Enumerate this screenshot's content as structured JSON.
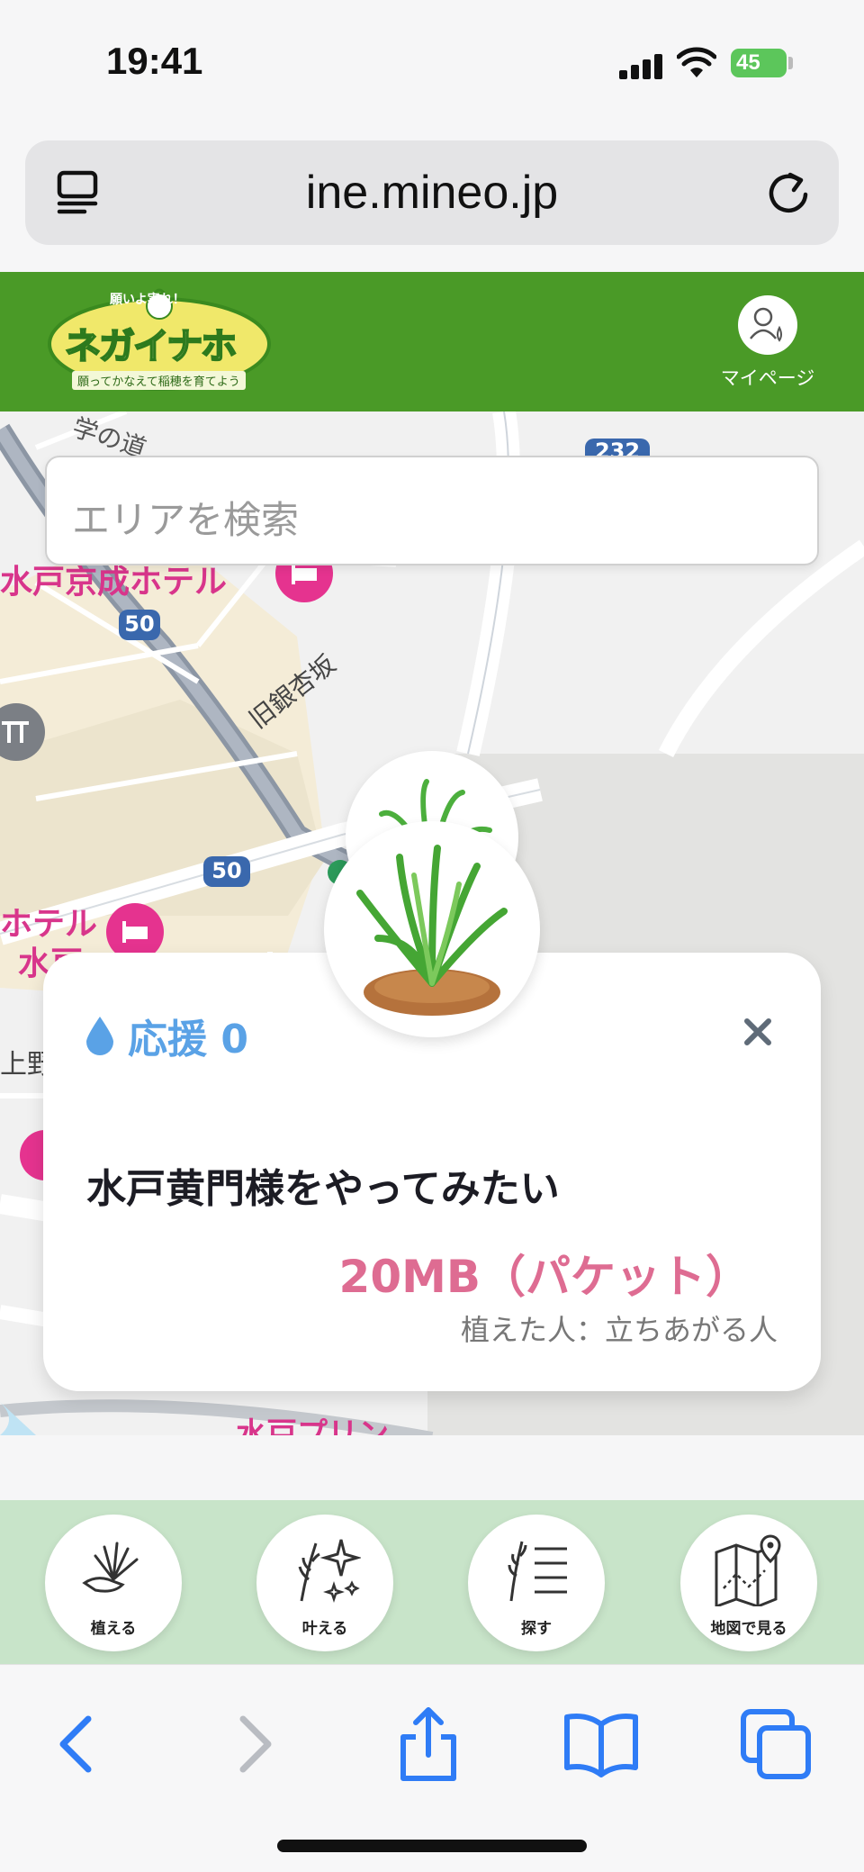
{
  "status_bar": {
    "time": "19:41",
    "battery": "45"
  },
  "browser": {
    "url": "ine.mineo.jp"
  },
  "header": {
    "logo": {
      "main": "ネガイナホ",
      "top": "願いよ実れ！",
      "sub": "願ってかなえて稲穂を育てよう"
    },
    "mypage_label": "マイページ"
  },
  "map": {
    "labels": [
      {
        "text": "学の道"
      },
      {
        "text": "232"
      },
      {
        "text": "水戸京成ホテル"
      },
      {
        "text": "50"
      },
      {
        "text": "旧銀杏坂"
      },
      {
        "text": "50"
      },
      {
        "text": "ホテル"
      },
      {
        "text": "水戸"
      },
      {
        "text": "上野"
      },
      {
        "text": "水戸プリン"
      }
    ]
  },
  "search": {
    "placeholder": "エリアを検索"
  },
  "card": {
    "support_label": "応援 0",
    "wish": "水戸黄門様をやってみたい",
    "reward": "20MB（パケット）",
    "planter": "植えた人：立ちあがる人"
  },
  "bottom_nav": [
    {
      "label": "植える",
      "icon": "plant-hand-icon"
    },
    {
      "label": "叶える",
      "icon": "rice-sparkle-icon"
    },
    {
      "label": "探す",
      "icon": "rice-list-icon"
    },
    {
      "label": "地図で見る",
      "icon": "map-pin-icon"
    }
  ],
  "colors": {
    "header_green": "#4a9a27",
    "nav_green": "#c8e4c9",
    "support_blue": "#5aa2e6",
    "reward_pink": "#de6c92",
    "safari_blue": "#2f7cf6"
  }
}
